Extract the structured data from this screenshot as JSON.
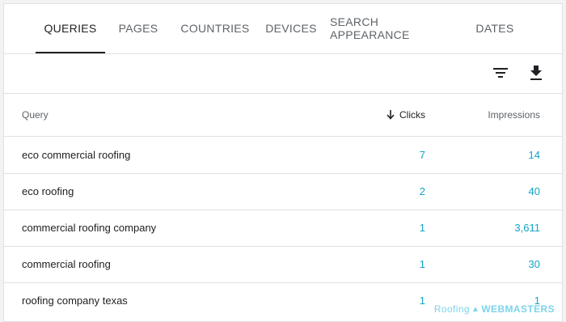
{
  "tabs": [
    {
      "label": "QUERIES",
      "active": true
    },
    {
      "label": "PAGES",
      "active": false
    },
    {
      "label": "COUNTRIES",
      "active": false
    },
    {
      "label": "DEVICES",
      "active": false
    },
    {
      "label": "SEARCH APPEARANCE",
      "active": false
    },
    {
      "label": "DATES",
      "active": false
    }
  ],
  "toolbar": {
    "filter_icon": "filter-icon",
    "download_icon": "download-icon"
  },
  "table": {
    "headers": {
      "query": "Query",
      "clicks": "Clicks",
      "impressions": "Impressions"
    },
    "sort": {
      "column": "clicks",
      "direction": "descending"
    },
    "rows": [
      {
        "query": "eco commercial roofing",
        "clicks": "7",
        "impressions": "14"
      },
      {
        "query": "eco roofing",
        "clicks": "2",
        "impressions": "40"
      },
      {
        "query": "commercial roofing company",
        "clicks": "1",
        "impressions": "3,611"
      },
      {
        "query": "commercial roofing",
        "clicks": "1",
        "impressions": "30"
      },
      {
        "query": "roofing company texas",
        "clicks": "1",
        "impressions": "1"
      }
    ]
  },
  "watermark": {
    "part1": "Roofing",
    "part2": "WEBMASTERS"
  },
  "colors": {
    "link": "#12a4c8",
    "text": "#202124",
    "muted": "#5f6368",
    "divider": "#e0e0e0"
  }
}
